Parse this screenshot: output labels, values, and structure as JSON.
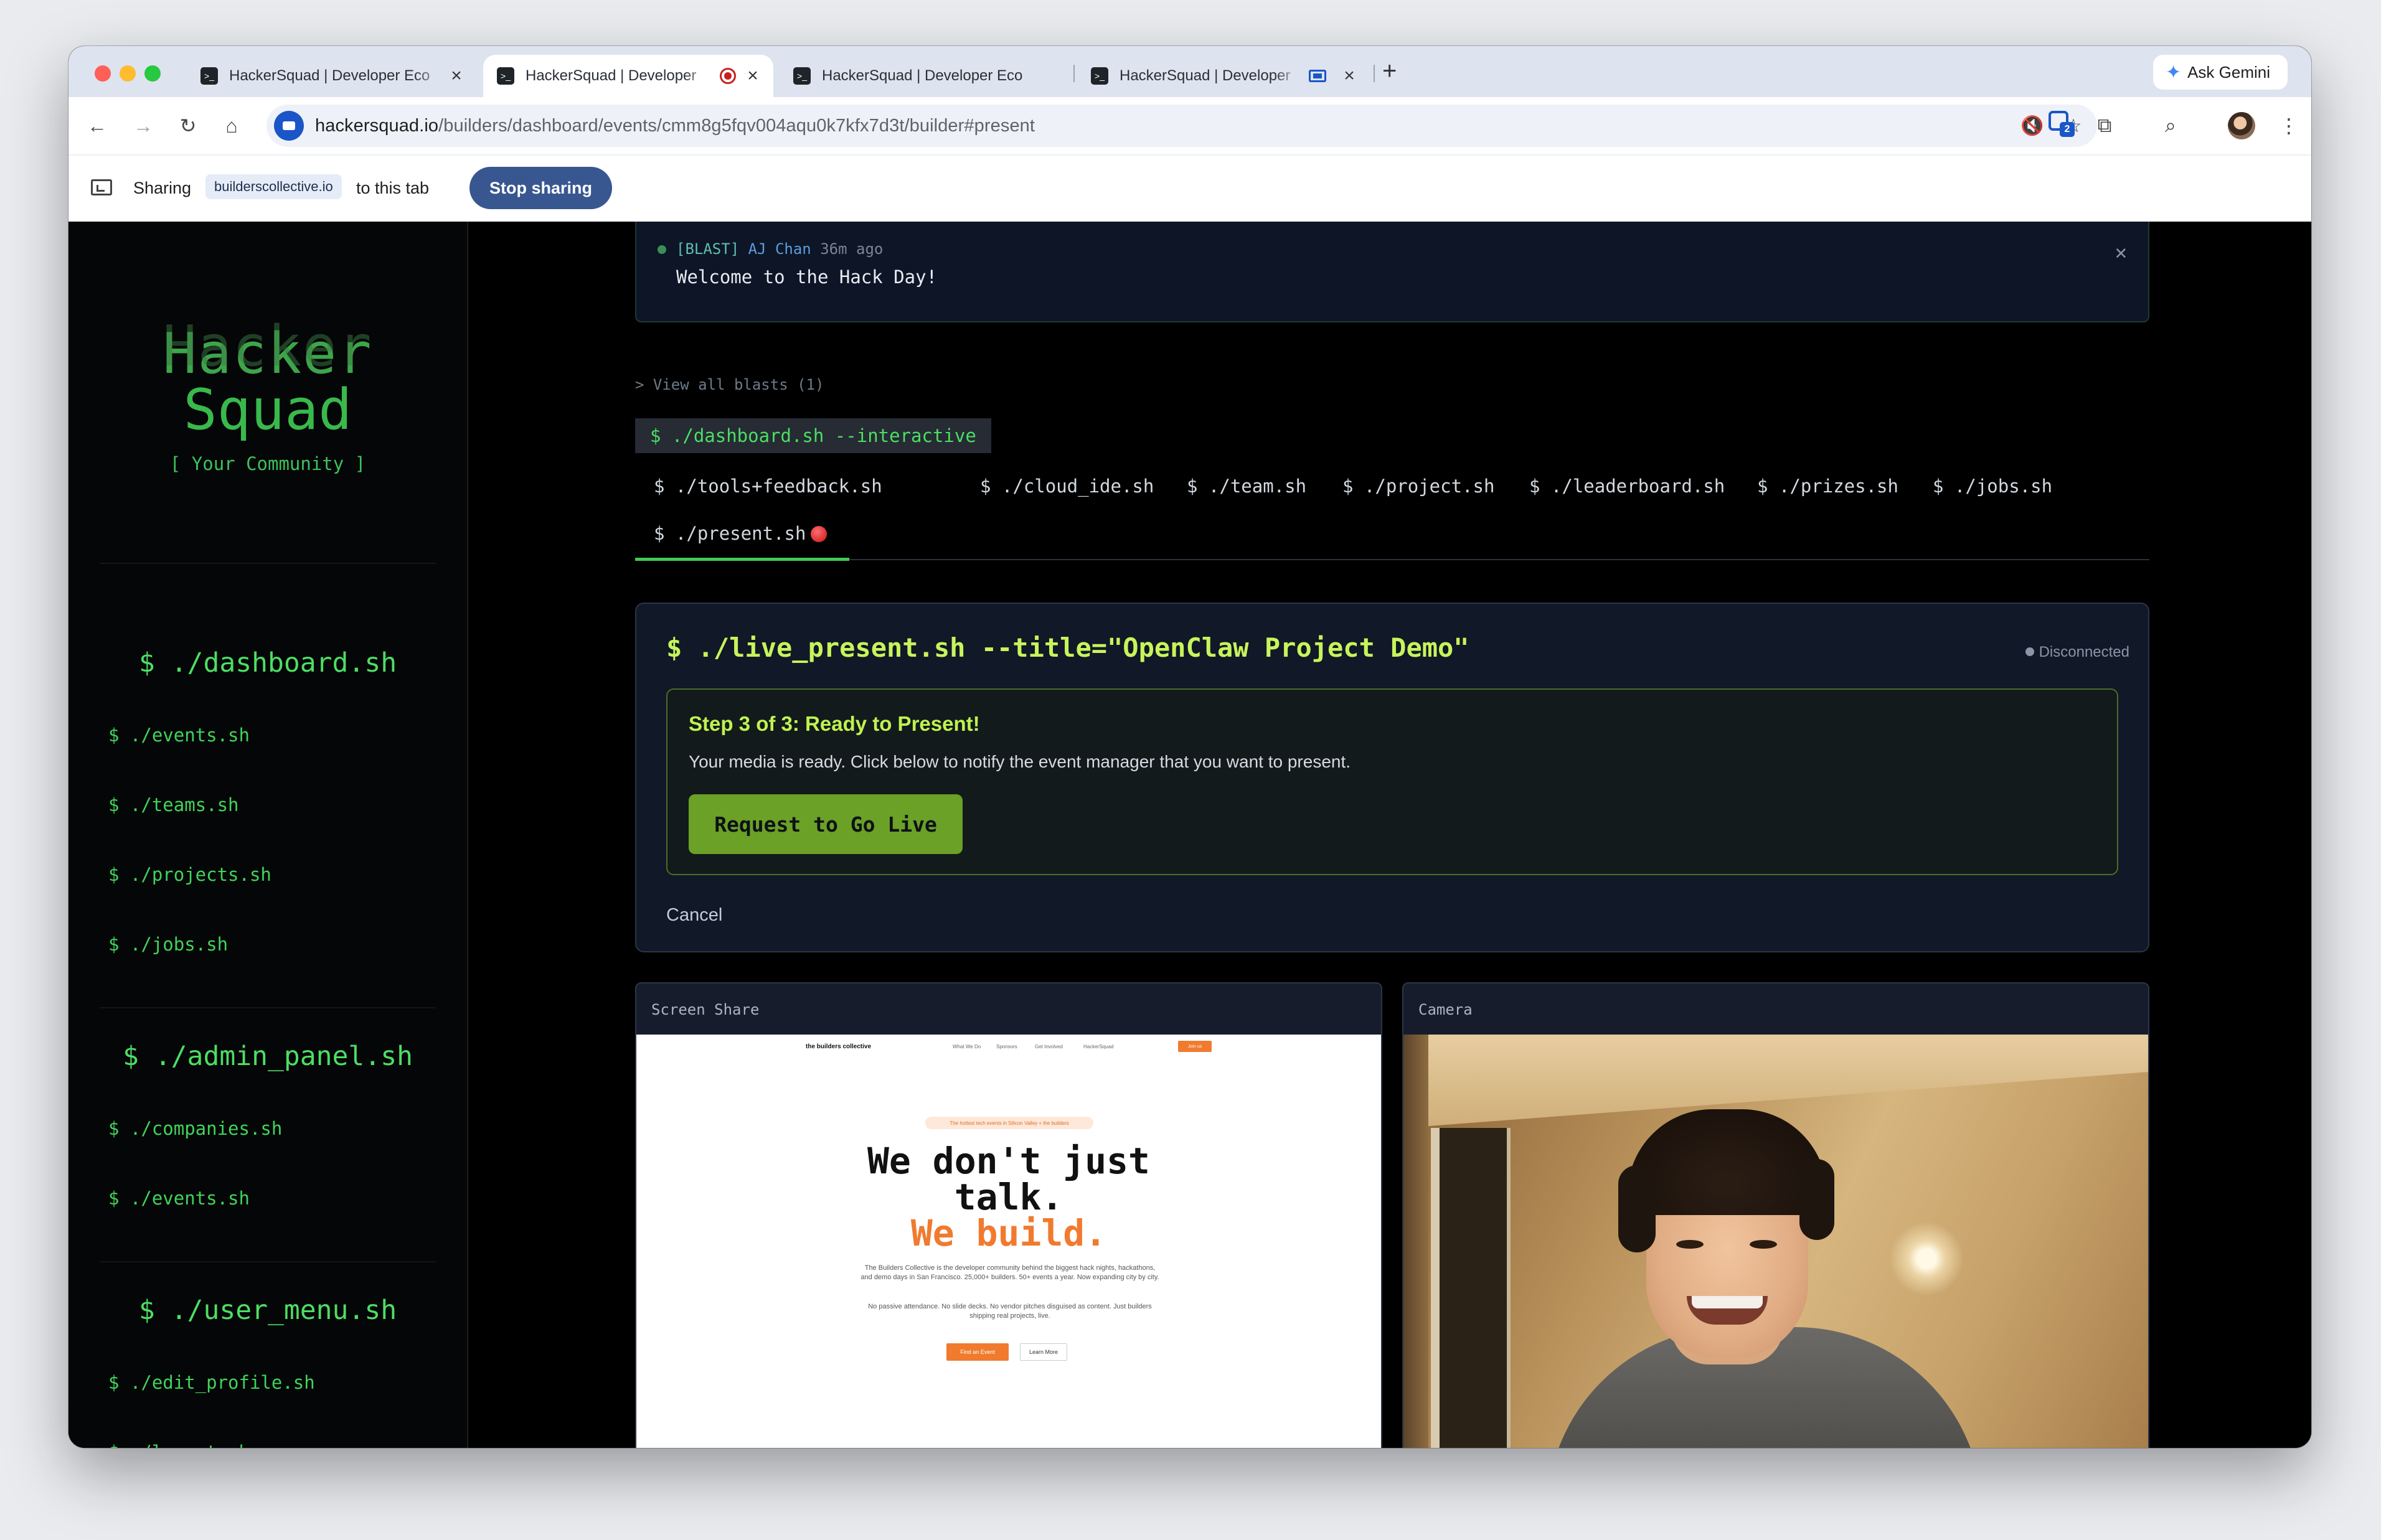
{
  "browser": {
    "tabs": [
      {
        "title": "HackerSquad | Developer Eco",
        "active": false,
        "indicator": "close"
      },
      {
        "title": "HackerSquad | Developer",
        "active": true,
        "indicator": "recording"
      },
      {
        "title": "HackerSquad | Developer Eco",
        "active": false,
        "indicator": "close"
      },
      {
        "title": "HackerSquad | Developer",
        "active": false,
        "indicator": "casting"
      }
    ],
    "new_tab": "+",
    "ask_gemini": "Ask Gemini",
    "url_host": "hackersquad.io",
    "url_path": "/builders/dashboard/events/cmm8g5fqv004aqu0k7kfx7d3t/builder#present",
    "extension_badge": "2",
    "icons": [
      "back-icon",
      "forward-icon",
      "reload-icon",
      "home-icon",
      "mute-icon",
      "bookmark-star-icon",
      "puzzle-icon",
      "search-tab-icon",
      "kebab-menu-icon"
    ]
  },
  "sharing_bar": {
    "label": "Sharing",
    "site": "builderscollective.io",
    "to_tab": "to this tab",
    "stop": "Stop sharing"
  },
  "sidebar": {
    "logo_line1": "Hacker",
    "logo_line2": "Squad",
    "tagline": "[ Your Community ]",
    "sections": [
      {
        "heading": "$ ./dashboard.sh",
        "items": [
          "$ ./events.sh",
          "$ ./teams.sh",
          "$ ./projects.sh",
          "$ ./jobs.sh"
        ]
      },
      {
        "heading": "$ ./admin_panel.sh",
        "items": [
          "$ ./companies.sh",
          "$ ./events.sh"
        ]
      },
      {
        "heading": "$ ./user_menu.sh",
        "items": [
          "$ ./edit_profile.sh",
          "$ ./logout.sh"
        ]
      }
    ]
  },
  "blast": {
    "tag": "[BLAST]",
    "author": "AJ Chan",
    "ago": "36m ago",
    "message": "Welcome to the Hack Day!",
    "close": "✕",
    "view_all": "> View all blasts (1)"
  },
  "command_chip": "$ ./dashboard.sh --interactive",
  "nav_tabs": [
    "$ ./tools+feedback.sh",
    "$ ./cloud_ide.sh",
    "$ ./team.sh",
    "$ ./project.sh",
    "$ ./leaderboard.sh",
    "$ ./prizes.sh",
    "$ ./jobs.sh",
    "$ ./present.sh"
  ],
  "active_tab": "$ ./present.sh",
  "present": {
    "title": "$ ./live_present.sh --title=\"OpenClaw Project Demo\"",
    "status": "Disconnected",
    "step_heading": "Step 3 of 3: Ready to Present!",
    "step_text": "Your media is ready. Click below to notify the event manager that you want to present.",
    "go_live": "Request to Go Live",
    "cancel": "Cancel"
  },
  "screen_share": {
    "label": "Screen Share",
    "site_brand": "the builders collective",
    "site_links": [
      "What We Do",
      "Sponsors",
      "Get Involved",
      "HackerSquad"
    ],
    "site_cta": "Join us",
    "pill": "The hottest tech events in Silicon Valley + the builders",
    "headline_1": "We don't just",
    "headline_2": "talk.",
    "headline_3": "We build.",
    "sub_1": "The Builders Collective is the developer community behind the biggest hack nights, hackathons, and demo days in San Francisco. 25,000+ builders. 50+ events a year. Now expanding city by city.",
    "sub_2": "No passive attendance. No slide decks. No vendor pitches disguised as content. Just builders shipping real projects, live.",
    "btn_primary": "Find an Event",
    "btn_secondary": "Learn More"
  },
  "camera": {
    "label": "Camera"
  },
  "colors": {
    "terminal_green": "#4cde63",
    "lime": "#c7f45b",
    "go_live_button": "#6aa126",
    "stop_sharing": "#385790",
    "site_orange": "#f07b2f"
  }
}
